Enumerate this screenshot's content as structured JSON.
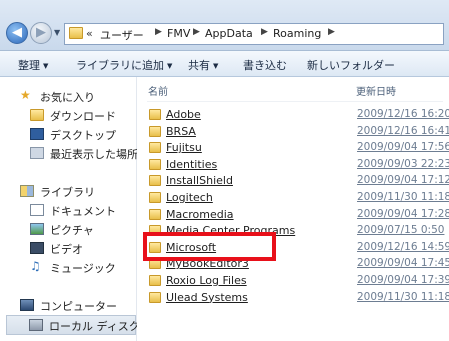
{
  "address_bar": {
    "chevron": "«",
    "crumbs": [
      "ユーザー",
      "FMV",
      "AppData",
      "Roaming"
    ]
  },
  "toolbar": {
    "organize": "整理",
    "add_to_library": "ライブラリに追加",
    "share": "共有",
    "burn": "書き込む",
    "new_folder": "新しいフォルダー"
  },
  "nav": {
    "favorites": "お気に入り",
    "downloads": "ダウンロード",
    "desktop": "デスクトップ",
    "recent": "最近表示した場所",
    "libraries": "ライブラリ",
    "documents": "ドキュメント",
    "pictures": "ピクチャ",
    "videos": "ビデオ",
    "music": "ミュージック",
    "computer": "コンピューター",
    "local_disk": "ローカル ディスク ("
  },
  "columns": {
    "name": "名前",
    "date": "更新日時"
  },
  "files": [
    {
      "name": "Adobe",
      "date": "2009/12/16 16:20"
    },
    {
      "name": "BRSA",
      "date": "2009/12/16 16:41"
    },
    {
      "name": "Fujitsu",
      "date": "2009/09/04 17:56"
    },
    {
      "name": "Identities",
      "date": "2009/09/03 22:23"
    },
    {
      "name": "InstallShield",
      "date": "2009/09/04 17:12"
    },
    {
      "name": "Logitech",
      "date": "2009/11/30 11:18"
    },
    {
      "name": "Macromedia",
      "date": "2009/09/04 17:28"
    },
    {
      "name": "Media Center Programs",
      "date": "2009/07/15 0:50"
    },
    {
      "name": "Microsoft",
      "date": "2009/12/16 14:59"
    },
    {
      "name": "MyBookEditor3",
      "date": "2009/09/04 17:45"
    },
    {
      "name": "Roxio Log Files",
      "date": "2009/09/04 17:39"
    },
    {
      "name": "Ulead Systems",
      "date": "2009/11/30 11:18"
    }
  ],
  "highlighted_item": "Microsoft",
  "colors": {
    "highlight_border": "#e8101a",
    "date_text": "#6d7d92"
  }
}
